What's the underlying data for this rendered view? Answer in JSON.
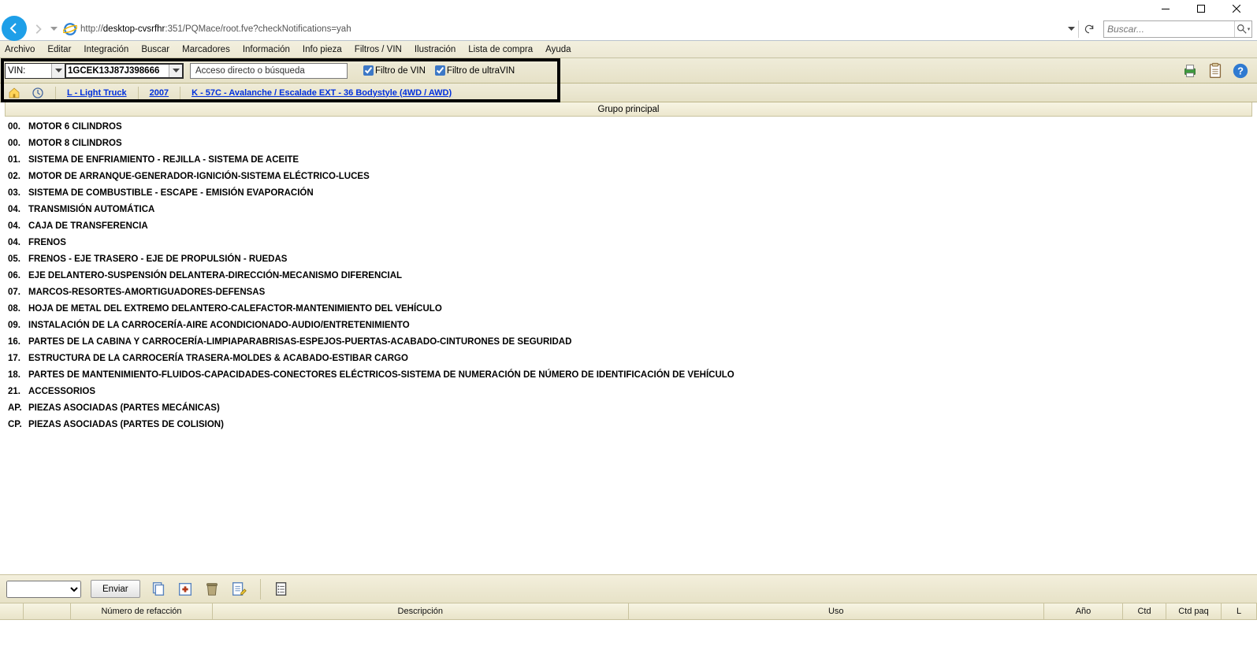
{
  "browser": {
    "url_prefix": "http://",
    "url_host": "desktop-cvsrfhr",
    "url_suffix": ":351/PQMace/root.fve?checkNotifications=yah",
    "search_placeholder": "Buscar..."
  },
  "menu": {
    "items": [
      "Archivo",
      "Editar",
      "Integración",
      "Buscar",
      "Marcadores",
      "Información",
      "Info pieza",
      "Filtros / VIN",
      "Ilustración",
      "Lista de compra",
      "Ayuda"
    ]
  },
  "toolbar": {
    "vin_label": "VIN:",
    "vin_value": "1GCEK13J87J398666",
    "direct_search_placeholder": "Acceso directo o búsqueda",
    "cb_vin": "Filtro de VIN",
    "cb_ultravin": "Filtro de ultraVIN",
    "cb_vin_checked": true,
    "cb_ultravin_checked": true
  },
  "crumbs": {
    "c1": "L - Light Truck",
    "c2": "2007",
    "c3": "K - 57C - Avalanche / Escalade EXT - 36 Bodystyle (4WD / AWD)"
  },
  "column_title": "Grupo principal",
  "groups": [
    {
      "code": "00.",
      "desc": "MOTOR 6 CILINDROS"
    },
    {
      "code": "00.",
      "desc": "MOTOR 8 CILINDROS"
    },
    {
      "code": "01.",
      "desc": "SISTEMA DE ENFRIAMIENTO - REJILLA - SISTEMA DE ACEITE"
    },
    {
      "code": "02.",
      "desc": "MOTOR DE ARRANQUE-GENERADOR-IGNICIÓN-SISTEMA ELÉCTRICO-LUCES"
    },
    {
      "code": "03.",
      "desc": "SISTEMA DE COMBUSTIBLE - ESCAPE - EMISIÓN EVAPORACIÓN"
    },
    {
      "code": "04.",
      "desc": "TRANSMISIÓN AUTOMÁTICA"
    },
    {
      "code": "04.",
      "desc": "CAJA DE TRANSFERENCIA"
    },
    {
      "code": "04.",
      "desc": "FRENOS"
    },
    {
      "code": "05.",
      "desc": "FRENOS - EJE TRASERO - EJE DE PROPULSIÓN - RUEDAS"
    },
    {
      "code": "06.",
      "desc": "EJE DELANTERO-SUSPENSIÓN DELANTERA-DIRECCIÓN-MECANISMO DIFERENCIAL"
    },
    {
      "code": "07.",
      "desc": "MARCOS-RESORTES-AMORTIGUADORES-DEFENSAS"
    },
    {
      "code": "08.",
      "desc": "HOJA DE METAL DEL EXTREMO DELANTERO-CALEFACTOR-MANTENIMIENTO DEL VEHÍCULO"
    },
    {
      "code": "09.",
      "desc": "INSTALACIÓN DE LA CARROCERÍA-AIRE ACONDICIONADO-AUDIO/ENTRETENIMIENTO"
    },
    {
      "code": "16.",
      "desc": "PARTES DE LA CABINA Y CARROCERÍA-LIMPIAPARABRISAS-ESPEJOS-PUERTAS-ACABADO-CINTURONES DE SEGURIDAD"
    },
    {
      "code": "17.",
      "desc": "ESTRUCTURA DE LA CARROCERÍA TRASERA-MOLDES & ACABADO-ESTIBAR CARGO"
    },
    {
      "code": "18.",
      "desc": "PARTES DE MANTENIMIENTO-FLUIDOS-CAPACIDADES-CONECTORES ELÉCTRICOS-SISTEMA DE NUMERACIÓN DE NÚMERO DE IDENTIFICACIÓN DE VEHÍCULO"
    },
    {
      "code": "21.",
      "desc": "ACCESSORIOS"
    },
    {
      "code": "AP.",
      "desc": "PIEZAS ASOCIADAS (PARTES MECÁNICAS)"
    },
    {
      "code": "CP.",
      "desc": "PIEZAS ASOCIADAS (PARTES DE COLISION)"
    }
  ],
  "bottom": {
    "send": "Enviar"
  },
  "table_headers": {
    "h1": "",
    "h2": "",
    "h3": "Número de refacción",
    "h4": "Descripción",
    "h5": "Uso",
    "h6": "Año",
    "h7": "Ctd",
    "h8": "Ctd paq",
    "h9": "L"
  }
}
